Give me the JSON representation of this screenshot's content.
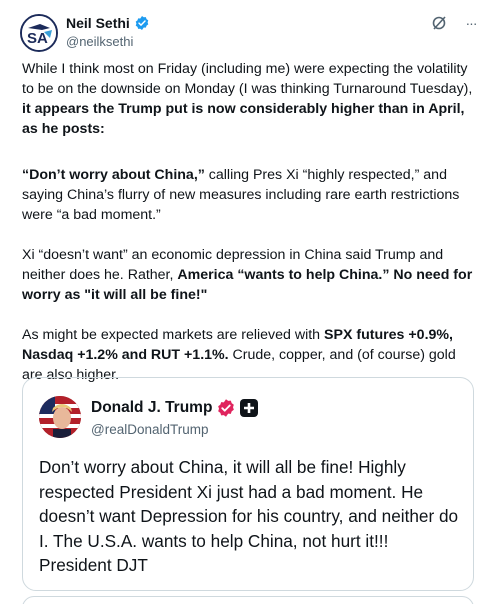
{
  "author": {
    "display_name": "Neil Sethi",
    "handle": "@neilksethi",
    "avatar_icon": "sethi-logo-avatar",
    "verified_icon": "blue-verified-icon"
  },
  "actions": {
    "grok_icon": "grok-icon",
    "more_icon": "more-icon",
    "more_label": "···"
  },
  "tweet": {
    "p1": {
      "t1": "While I think most on Friday (including me) were expecting the volatility to be on the downside on Monday (I was thinking Turnaround Tuesday), ",
      "b1": "it appears the Trump put is now considerably higher than in April, as he posts:"
    },
    "p2": {
      "b1": "“Don’t worry about China,”",
      "t1": " calling Pres Xi “highly respected,” and saying China’s flurry of new measures including rare earth restrictions were “a bad moment.”"
    },
    "p3": {
      "t1": "Xi “doesn’t want” an economic depression in China said Trump and neither does he. Rather, ",
      "b1": "America “wants to help China.”  No need for worry as \"it will all be fine!\""
    },
    "p4": {
      "t1": "As might be expected markets are relieved with ",
      "b1": "SPX futures +0.9%, Nasdaq +1.2% and RUT +1.1%.",
      "t2": " Crude, copper, and (of course) gold are also higher."
    }
  },
  "quote": {
    "display_name": "Donald J. Trump",
    "handle": "@realDonaldTrump",
    "avatar_icon": "trump-avatar",
    "badge_icon": "red-verified-icon",
    "affiliation_icon": "truth-social-plus-icon",
    "text": "Don’t worry about China, it will all be fine! Highly respected President Xi just had a bad moment. He doesn’t want Depression for his country, and neither do I. The U.S.A. wants to help China, not hurt it!!! President DJT"
  },
  "colors": {
    "text": "#0f1419",
    "secondary": "#536471",
    "border": "#cfd9de",
    "verified_blue": "#1d9bf0",
    "trump_badge": "#e0245e"
  }
}
